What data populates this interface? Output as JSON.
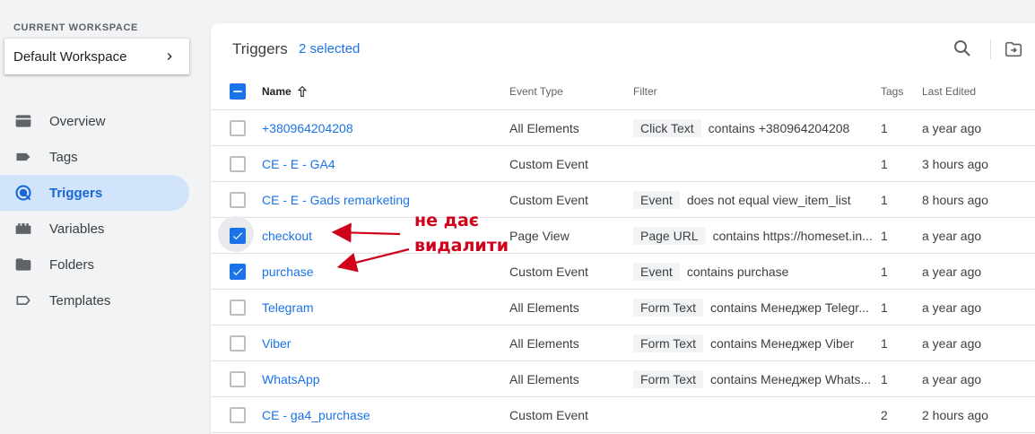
{
  "sidebar": {
    "workspace_label": "CURRENT WORKSPACE",
    "workspace_name": "Default Workspace",
    "items": [
      {
        "label": "Overview",
        "icon": "overview-icon",
        "active": false
      },
      {
        "label": "Tags",
        "icon": "tag-icon",
        "active": false
      },
      {
        "label": "Triggers",
        "icon": "trigger-icon",
        "active": true
      },
      {
        "label": "Variables",
        "icon": "variables-icon",
        "active": false
      },
      {
        "label": "Folders",
        "icon": "folder-icon",
        "active": false
      },
      {
        "label": "Templates",
        "icon": "templates-icon",
        "active": false
      }
    ]
  },
  "main": {
    "title": "Triggers",
    "selected": "2 selected"
  },
  "table": {
    "columns": {
      "name": "Name",
      "event_type": "Event Type",
      "filter": "Filter",
      "tags": "Tags",
      "last_edited": "Last Edited"
    },
    "rows": [
      {
        "name": "+380964204208",
        "event_type": "All Elements",
        "chip": "Click Text",
        "filter": "contains +380964204208",
        "tags": "1",
        "last_edited": "a year ago",
        "checked": false
      },
      {
        "name": "CE - E - GA4",
        "event_type": "Custom Event",
        "chip": "",
        "filter": "",
        "tags": "1",
        "last_edited": "3 hours ago",
        "checked": false
      },
      {
        "name": "CE - E - Gads remarketing",
        "event_type": "Custom Event",
        "chip": "Event",
        "filter": "does not equal view_item_list",
        "tags": "1",
        "last_edited": "8 hours ago",
        "checked": false
      },
      {
        "name": "checkout",
        "event_type": "Page View",
        "chip": "Page URL",
        "filter": "contains https://homeset.in...",
        "tags": "1",
        "last_edited": "a year ago",
        "checked": true
      },
      {
        "name": "purchase",
        "event_type": "Custom Event",
        "chip": "Event",
        "filter": "contains purchase",
        "tags": "1",
        "last_edited": "a year ago",
        "checked": true
      },
      {
        "name": "Telegram",
        "event_type": "All Elements",
        "chip": "Form Text",
        "filter": "contains Менеджер Telegr...",
        "tags": "1",
        "last_edited": "a year ago",
        "checked": false
      },
      {
        "name": "Viber",
        "event_type": "All Elements",
        "chip": "Form Text",
        "filter": "contains Менеджер Viber",
        "tags": "1",
        "last_edited": "a year ago",
        "checked": false
      },
      {
        "name": "WhatsApp",
        "event_type": "All Elements",
        "chip": "Form Text",
        "filter": "contains Менеджер Whats...",
        "tags": "1",
        "last_edited": "a year ago",
        "checked": false
      },
      {
        "name": "CE - ga4_purchase",
        "event_type": "Custom Event",
        "chip": "",
        "filter": "",
        "tags": "2",
        "last_edited": "2 hours ago",
        "checked": false
      }
    ]
  },
  "annotation": {
    "line1": "не дає",
    "line2": "видалити",
    "color": "#d0021b"
  },
  "colors": {
    "accent": "#1a73e8",
    "active_nav_bg": "#d2e3fc"
  }
}
